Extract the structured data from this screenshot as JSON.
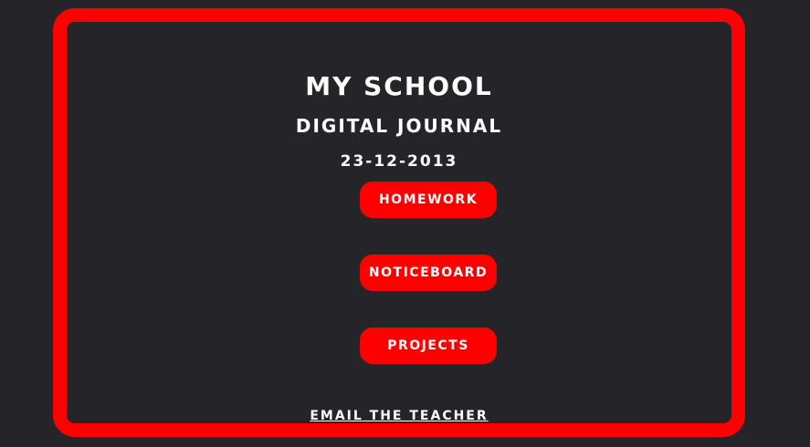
{
  "header": {
    "title": "MY SCHOOL",
    "subtitle": "DIGITAL JOURNAL",
    "date": "23-12-2013"
  },
  "nav": {
    "buttons": [
      {
        "label": "HOMEWORK"
      },
      {
        "label": "NOTICEBOARD"
      },
      {
        "label": "PROJECTS"
      }
    ]
  },
  "footer": {
    "email_label": "EMAIL THE TEACHER"
  },
  "colors": {
    "background": "#252428",
    "frame": "#ff0000",
    "button": "#ff0000",
    "text": "#ffffff"
  }
}
